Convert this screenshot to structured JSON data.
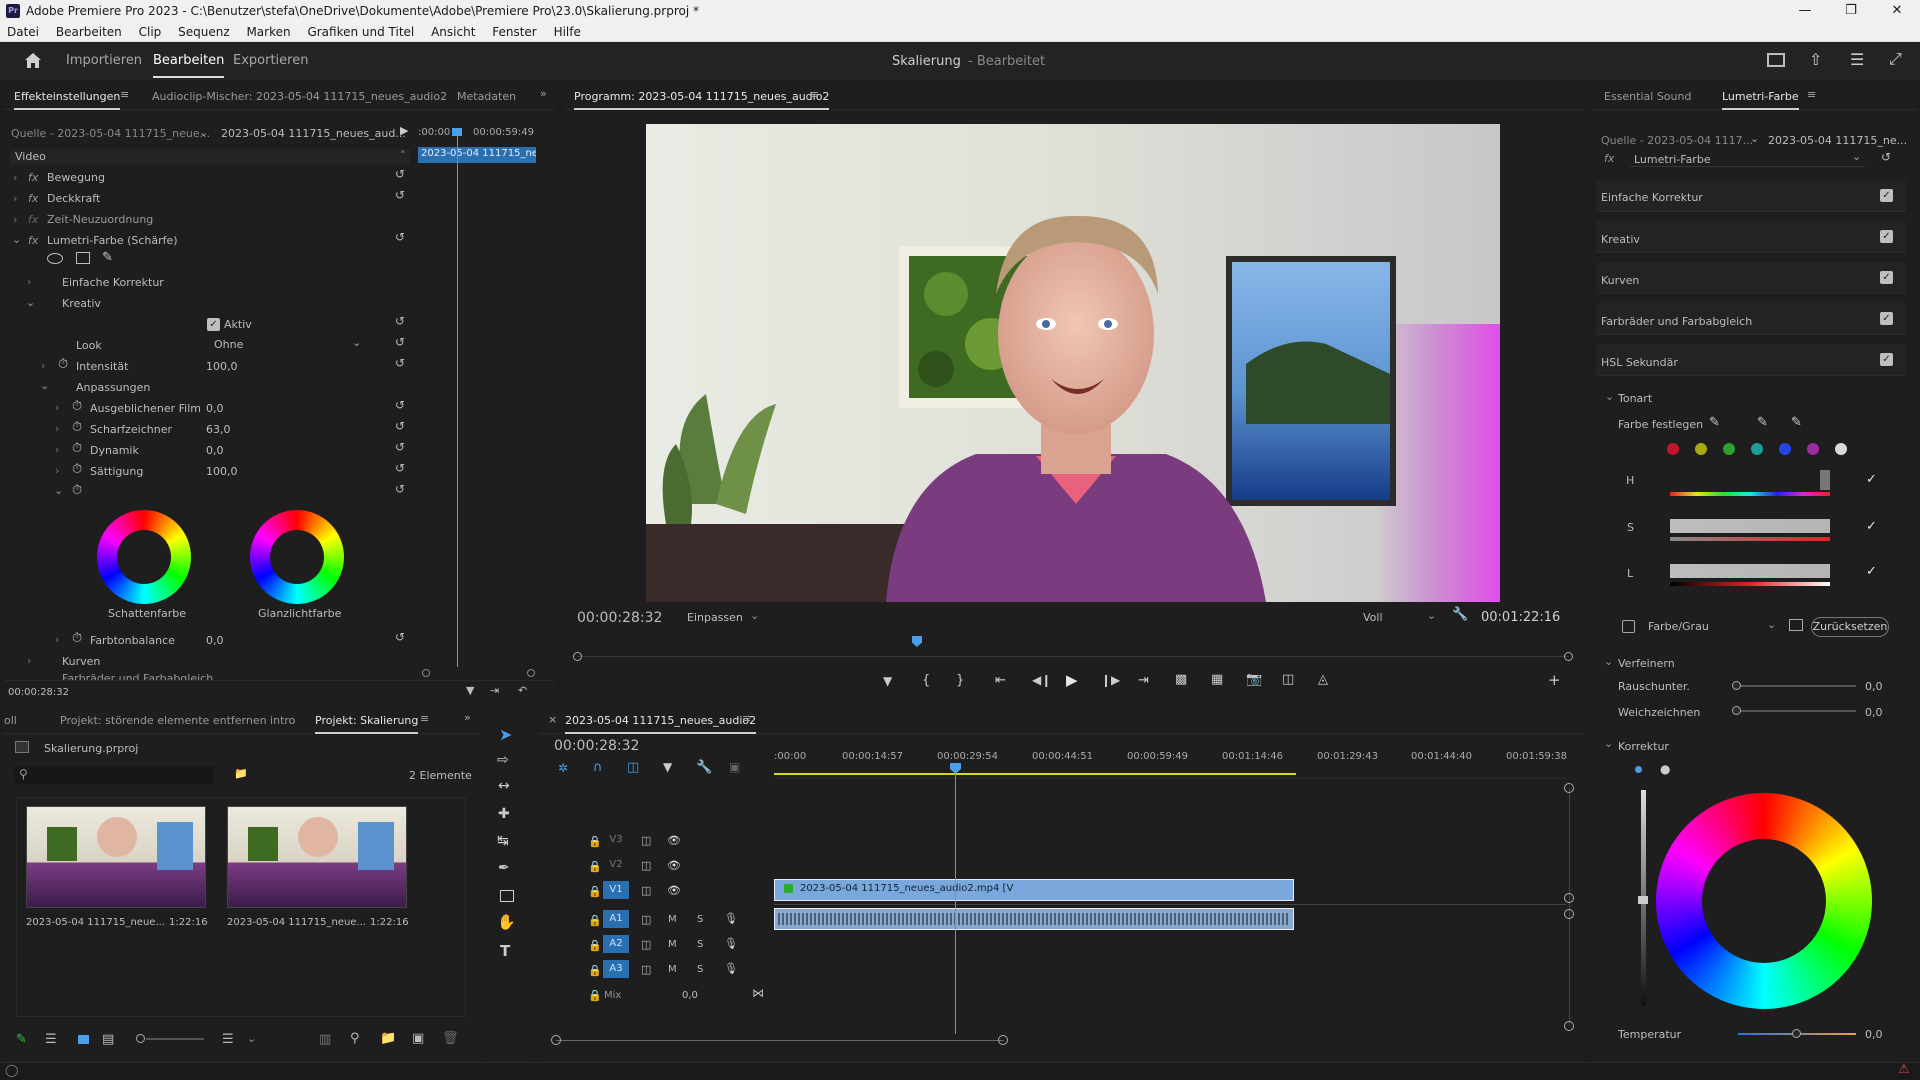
{
  "window": {
    "title": "Adobe Premiere Pro 2023 - C:\\Benutzer\\stefa\\OneDrive\\Dokumente\\Adobe\\Premiere Pro\\23.0\\Skalierung.prproj *",
    "app_icon": "Pr"
  },
  "menu": [
    "Datei",
    "Bearbeiten",
    "Clip",
    "Sequenz",
    "Marken",
    "Grafiken und Titel",
    "Ansicht",
    "Fenster",
    "Hilfe"
  ],
  "header": {
    "nav": [
      "Importieren",
      "Bearbeiten",
      "Exportieren"
    ],
    "active_nav": "Bearbeiten",
    "project_name": "Skalierung",
    "project_state": "- Bearbeitet"
  },
  "effects": {
    "tabs": [
      "Effekteinstellungen",
      "Audioclip-Mischer: 2023-05-04 111715_neues_audio2",
      "Metadaten"
    ],
    "source_label": "Quelle - 2023-05-04 111715_neue...",
    "sequence_label": "2023-05-04 111715_neues_aud...",
    "time_start": ":00:00",
    "time_end": "00:00:59:49",
    "clip_label": "2023-05-04 111715_ne",
    "video_header": "Video",
    "fx_rows": [
      "Bewegung",
      "Deckkraft",
      "Zeit-Neuzuordnung",
      "Lumetri-Farbe (Schärfe)"
    ],
    "einfache": "Einfache Korrektur",
    "kreativ": "Kreativ",
    "aktiv": "Aktiv",
    "look_label": "Look",
    "look_value": "Ohne",
    "intensitaet_label": "Intensität",
    "intensitaet_value": "100,0",
    "anpassungen": "Anpassungen",
    "params": [
      {
        "label": "Ausgeblichener Film",
        "value": "0,0"
      },
      {
        "label": "Scharfzeichner",
        "value": "63,0"
      },
      {
        "label": "Dynamik",
        "value": "0,0"
      },
      {
        "label": "Sättigung",
        "value": "100,0"
      }
    ],
    "wheel1": "Schattenfarbe",
    "wheel2": "Glanzlichtfarbe",
    "farbtonbalance_label": "Farbtonbalance",
    "farbtonbalance_value": "0,0",
    "kurven": "Kurven",
    "farbrad": "Farbräder und Farbabgleich",
    "timecode": "00:00:28:32"
  },
  "program": {
    "title": "Programm: 2023-05-04 111715_neues_audio2",
    "timecode": "00:00:28:32",
    "fit": "Einpassen",
    "quality": "Voll",
    "duration": "00:01:22:16"
  },
  "lumetri": {
    "tabs": [
      "Essential Sound",
      "Lumetri-Farbe"
    ],
    "source_label": "Quelle - 2023-05-04 1117...",
    "sequence_label": "2023-05-04 111715_ne...",
    "effect_name": "Lumetri-Farbe",
    "sections": [
      "Einfache Korrektur",
      "Kreativ",
      "Kurven",
      "Farbräder und Farbabgleich",
      "HSL Sekundär"
    ],
    "tonart": "Tonart",
    "farbe_festlegen": "Farbe festlegen",
    "swatches": [
      "#c0152a",
      "#a8a814",
      "#2ea12e",
      "#1f9f9a",
      "#2447e0",
      "#a12ca1",
      "#d9d9d9"
    ],
    "h": "H",
    "s": "S",
    "l": "L",
    "farbe_grau": "Farbe/Grau",
    "zuruecksetzen": "Zurücksetzen",
    "verfeinern": "Verfeinern",
    "rauschunter_label": "Rauschunter.",
    "rauschunter_value": "0,0",
    "weichzeichnen_label": "Weichzeichnen",
    "weichzeichnen_value": "0,0",
    "korrektur": "Korrektur",
    "temperatur_label": "Temperatur",
    "temperatur_value": "0,0"
  },
  "project": {
    "tabs": [
      "oll",
      "Projekt: störende elemente entfernen intro",
      "Projekt: Skalierung"
    ],
    "file": "Skalierung.prproj",
    "count": "2 Elemente",
    "items": [
      {
        "name": "2023-05-04 111715_neue...",
        "duration": "1:22:16"
      },
      {
        "name": "2023-05-04 111715_neue...",
        "duration": "1:22:16"
      }
    ]
  },
  "timeline": {
    "tab": "2023-05-04 111715_neues_audio2",
    "timecode": "00:00:28:32",
    "ruler": [
      ":00:00",
      "00:00:14:57",
      "00:00:29:54",
      "00:00:44:51",
      "00:00:59:49",
      "00:01:14:46",
      "00:01:29:43",
      "00:01:44:40",
      "00:01:59:38"
    ],
    "video_tracks": [
      "V3",
      "V2",
      "V1"
    ],
    "audio_tracks": [
      "A1",
      "A2",
      "A3"
    ],
    "mix_label": "Mix",
    "mix_value": "0,0",
    "m": "M",
    "s": "S",
    "video_clip": "2023-05-04 111715_neues_audio2.mp4 [V"
  }
}
